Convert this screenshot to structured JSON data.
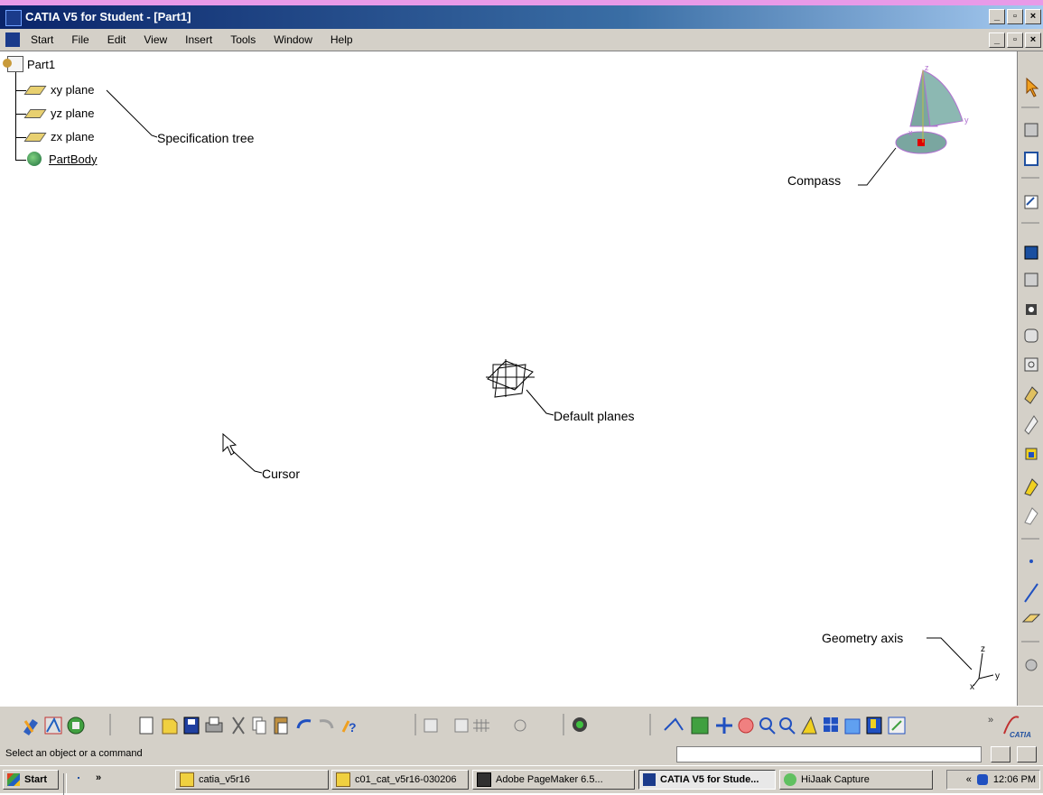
{
  "window": {
    "title": "CATIA V5 for Student - [Part1]",
    "controls": [
      "_",
      "▫",
      "×"
    ]
  },
  "menu": {
    "items": [
      "Start",
      "File",
      "Edit",
      "View",
      "Insert",
      "Tools",
      "Window",
      "Help"
    ],
    "doc_controls": [
      "_",
      "▫",
      "×"
    ]
  },
  "tree": {
    "root": "Part1",
    "items": [
      "xy plane",
      "yz plane",
      "zx plane",
      "PartBody"
    ]
  },
  "annotations": {
    "spec_tree": "Specification tree",
    "compass": "Compass",
    "default_planes": "Default planes",
    "cursor": "Cursor",
    "geometry_axis": "Geometry axis"
  },
  "axis_labels": {
    "x": "x",
    "y": "y",
    "z": "z"
  },
  "compass_labels": {
    "z": "z",
    "y": "y",
    "x": "x"
  },
  "status": {
    "text": "Select an object or a command",
    "command_value": ""
  },
  "taskbar": {
    "start": "Start",
    "buttons": [
      "catia_v5r16",
      "c01_cat_v5r16-030206",
      "Adobe PageMaker 6.5...",
      "CATIA V5 for Stude...",
      "HiJaak Capture"
    ],
    "time": "12:06 PM",
    "chevron": "»",
    "tray_arrows": "«"
  },
  "colors": {
    "title_bg": "#0a246a",
    "chrome": "#d4d0c8",
    "accent_pink": "#e89ae8"
  },
  "icons": {
    "right_toolbar": [
      "select-arrow",
      "sketcher",
      "axis-system",
      "part-design",
      "sketch-based",
      "pad",
      "hole",
      "rib",
      "slot",
      "stiffener",
      "multi-section",
      "remove",
      "dress-up",
      "shell",
      "boolean",
      "point",
      "line",
      "plane",
      "show-hide"
    ],
    "bottom_toolbar": [
      "workbench",
      "knowledge",
      "catalog",
      "new",
      "open",
      "save",
      "print",
      "cut",
      "copy",
      "paste",
      "undo",
      "redo",
      "whats-this",
      "measure",
      "grid",
      "snap",
      "compass-toggle",
      "analysis",
      "fly",
      "fit-all",
      "pan",
      "rotate",
      "zoom-in",
      "zoom-out",
      "normal-view",
      "quick-view",
      "views",
      "render-style",
      "hide-show",
      "swap",
      "catia-logo"
    ]
  }
}
